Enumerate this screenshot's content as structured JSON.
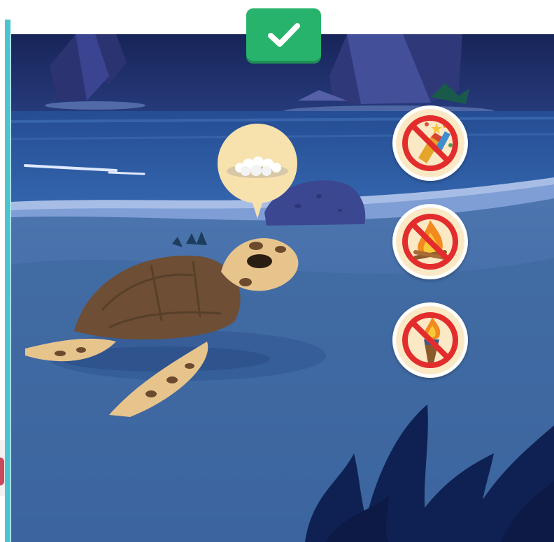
{
  "scene": {
    "colors": {
      "sky": "#1b2a63",
      "sea": "#2f5fa3",
      "surf": "#9fb7e3",
      "sand": "#3e6aa5",
      "foliage": "#0f2153",
      "accent_check": "#27b36b",
      "teal_rail": "#4cc4cf"
    },
    "elements": [
      "sea-turtle",
      "turtle-eggs",
      "rock"
    ]
  },
  "toolbar": {
    "check_icon": "checkmark-icon"
  },
  "bubble": {
    "icon": "turtle-eggs-icon"
  },
  "badges": [
    {
      "id": "no-fireworks",
      "icon": "no-fireworks-icon"
    },
    {
      "id": "no-campfire",
      "icon": "no-campfire-icon"
    },
    {
      "id": "no-torch",
      "icon": "no-torch-icon"
    }
  ]
}
